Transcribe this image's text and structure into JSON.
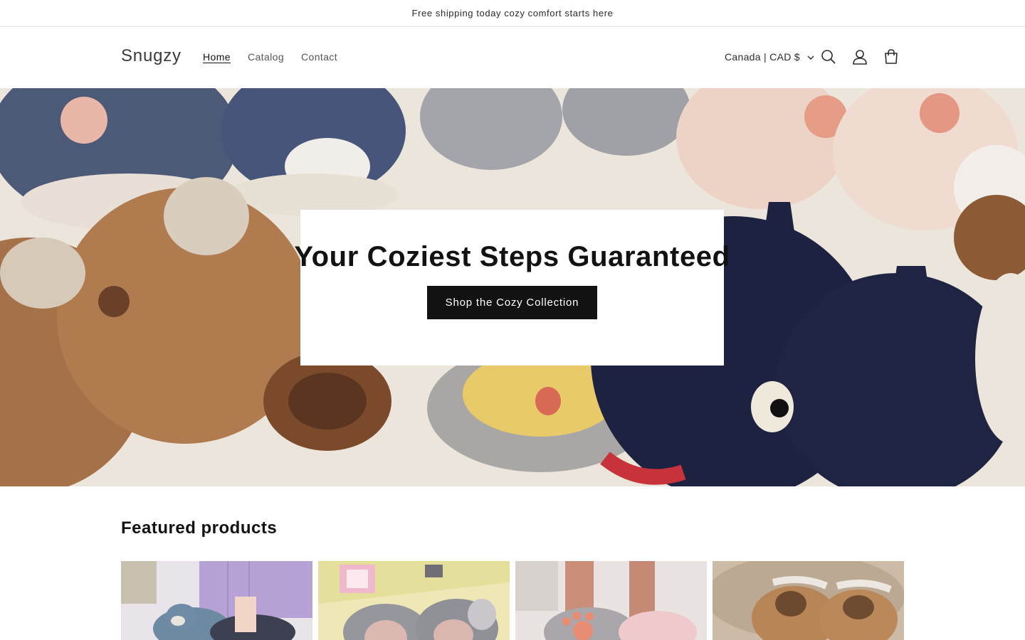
{
  "announcement": {
    "text": "Free shipping today cozy comfort starts here"
  },
  "header": {
    "logo": "Snugzy",
    "nav": [
      {
        "label": "Home",
        "active": true
      },
      {
        "label": "Catalog",
        "active": false
      },
      {
        "label": "Contact",
        "active": false
      }
    ],
    "country_selector": "Canada | CAD $",
    "icons": [
      "search-icon",
      "account-icon",
      "cart-icon"
    ]
  },
  "hero": {
    "title": "Your Coziest Steps Guaranteed",
    "button_label": "Shop the Cozy Collection"
  },
  "featured": {
    "title": "Featured products",
    "products": [
      {
        "image": "otter-slipper-photo"
      },
      {
        "image": "elephant-slipper-photo"
      },
      {
        "image": "paw-slipper-photo"
      },
      {
        "image": "capybara-slipper-photo"
      }
    ]
  },
  "colors": {
    "text": "#121212",
    "button_bg": "#121212",
    "button_text": "#ffffff",
    "border": "#e6e6e6"
  }
}
